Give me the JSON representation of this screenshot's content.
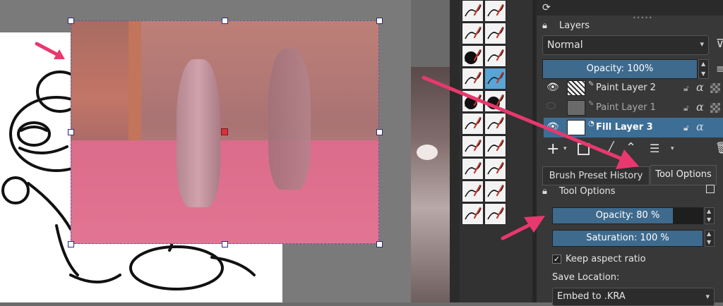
{
  "canvas": {
    "handles": [
      "top-left",
      "top-center",
      "top-right",
      "middle-left",
      "middle-right",
      "bottom-left",
      "bottom-center",
      "bottom-right"
    ]
  },
  "brush_panel": {
    "rows": 10,
    "cols": 2,
    "selected_index": 7
  },
  "layers_docker": {
    "refresh_icon": "refresh-icon",
    "title": "Layers",
    "blend_mode": "Normal",
    "filter_icon": "filter-icon",
    "opacity_label": "Opacity:  100%",
    "opacity_value": 100,
    "layers": [
      {
        "name": "Paint Layer 2",
        "visible": true,
        "dim": false,
        "selected": false
      },
      {
        "name": "Paint Layer 1",
        "visible": false,
        "dim": true,
        "selected": false
      },
      {
        "name": "Fill Layer 3",
        "visible": true,
        "dim": false,
        "selected": true
      }
    ],
    "toolbar_icons": [
      "add-icon",
      "chevron-down-icon",
      "copy-icon",
      "edit-icon",
      "move-up-icon",
      "properties-icon",
      "chevron-down-icon",
      "delete-icon"
    ]
  },
  "tool_tabs": {
    "tab1": "Brush Preset History",
    "tab2": "Tool Options",
    "active": "Tool Options"
  },
  "tool_options": {
    "title": "Tool Options",
    "opacity_label": "Opacity: 80 %",
    "opacity_value": 80,
    "saturation_label": "Saturation: 100 %",
    "saturation_value": 100,
    "keep_aspect_label": "Keep aspect ratio",
    "keep_aspect_checked": true,
    "save_location_label": "Save Location:",
    "save_location_value": "Embed to .KRA"
  },
  "colors": {
    "accent": "#3e6a8d",
    "annotation_arrow": "#e8386d",
    "selected_layer": "#3d6e96"
  }
}
